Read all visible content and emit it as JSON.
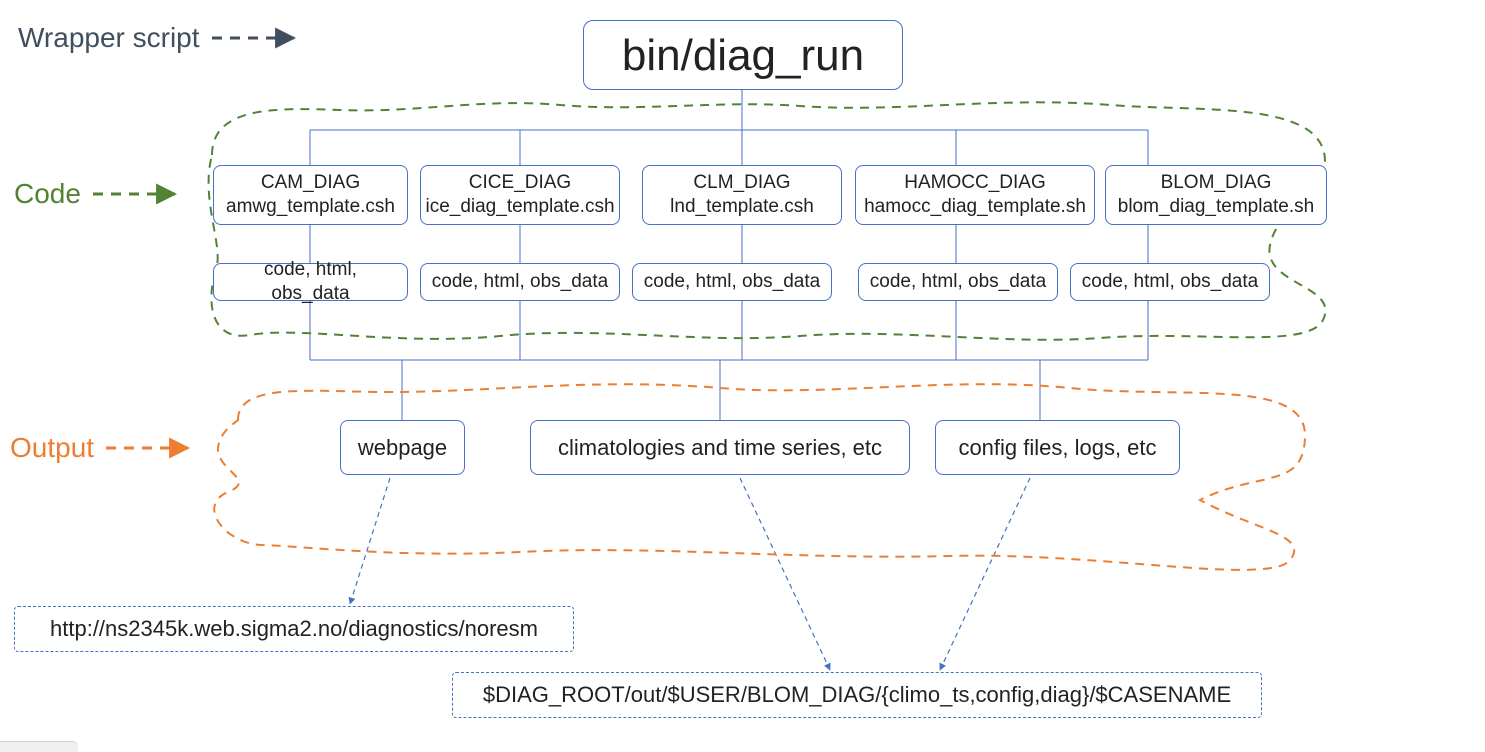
{
  "legend": {
    "wrapper": "Wrapper script",
    "code": "Code",
    "output": "Output"
  },
  "root": "bin/diag_run",
  "modules": {
    "cam": {
      "line1": "CAM_DIAG",
      "line2": "amwg_template.csh",
      "sub": "code, html, obs_data"
    },
    "cice": {
      "line1": "CICE_DIAG",
      "line2": "ice_diag_template.csh",
      "sub": "code, html, obs_data"
    },
    "clm": {
      "line1": "CLM_DIAG",
      "line2": "lnd_template.csh",
      "sub": "code, html, obs_data"
    },
    "hamocc": {
      "line1": "HAMOCC_DIAG",
      "line2": "hamocc_diag_template.sh",
      "sub": "code, html, obs_data"
    },
    "blom": {
      "line1": "BLOM_DIAG",
      "line2": "blom_diag_template.sh",
      "sub": "code, html, obs_data"
    }
  },
  "outputs": {
    "webpage": "webpage",
    "climo": "climatologies and time series, etc",
    "config": "config files, logs, etc"
  },
  "targets": {
    "url": "http://ns2345k.web.sigma2.no/diagnostics/noresm",
    "path": "$DIAG_ROOT/out/$USER/BLOM_DIAG/{climo_ts,config,diag}/$CASENAME"
  }
}
